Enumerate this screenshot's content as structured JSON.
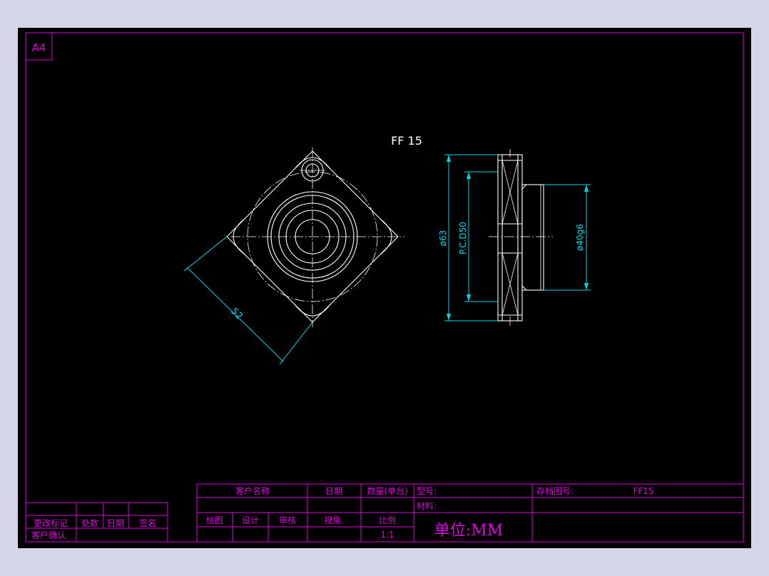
{
  "sheet": {
    "size_label": "A4",
    "part_title": "FF 15"
  },
  "dimensions": {
    "flange_diagonal": "52",
    "outer_diameter": "ø63",
    "pitch_circle": "P.C.D50",
    "spigot_diameter": "ø40g6"
  },
  "title_block": {
    "customer_name": "客户名称",
    "date": "日期",
    "quantity": "数量(单台)",
    "model_label": "型号:",
    "archive_label": "存档图号:",
    "archive_value": "FF15",
    "material_label": "材料:",
    "drawn": "绘图",
    "design": "设计",
    "review": "审核",
    "view_angle": "视角.",
    "scale_label": "比例",
    "scale_value": "1:1",
    "unit": "单位:MM"
  },
  "revision_block": {
    "change_mark": "更改标记",
    "count": "处数",
    "date": "日期",
    "sign": "签名",
    "customer_confirm": "客户确认"
  },
  "colors": {
    "frame": "#e100e1",
    "geometry": "#ffffff",
    "dimension": "#00d7e6",
    "background": "#000000",
    "outer": "#d4d5e7"
  }
}
